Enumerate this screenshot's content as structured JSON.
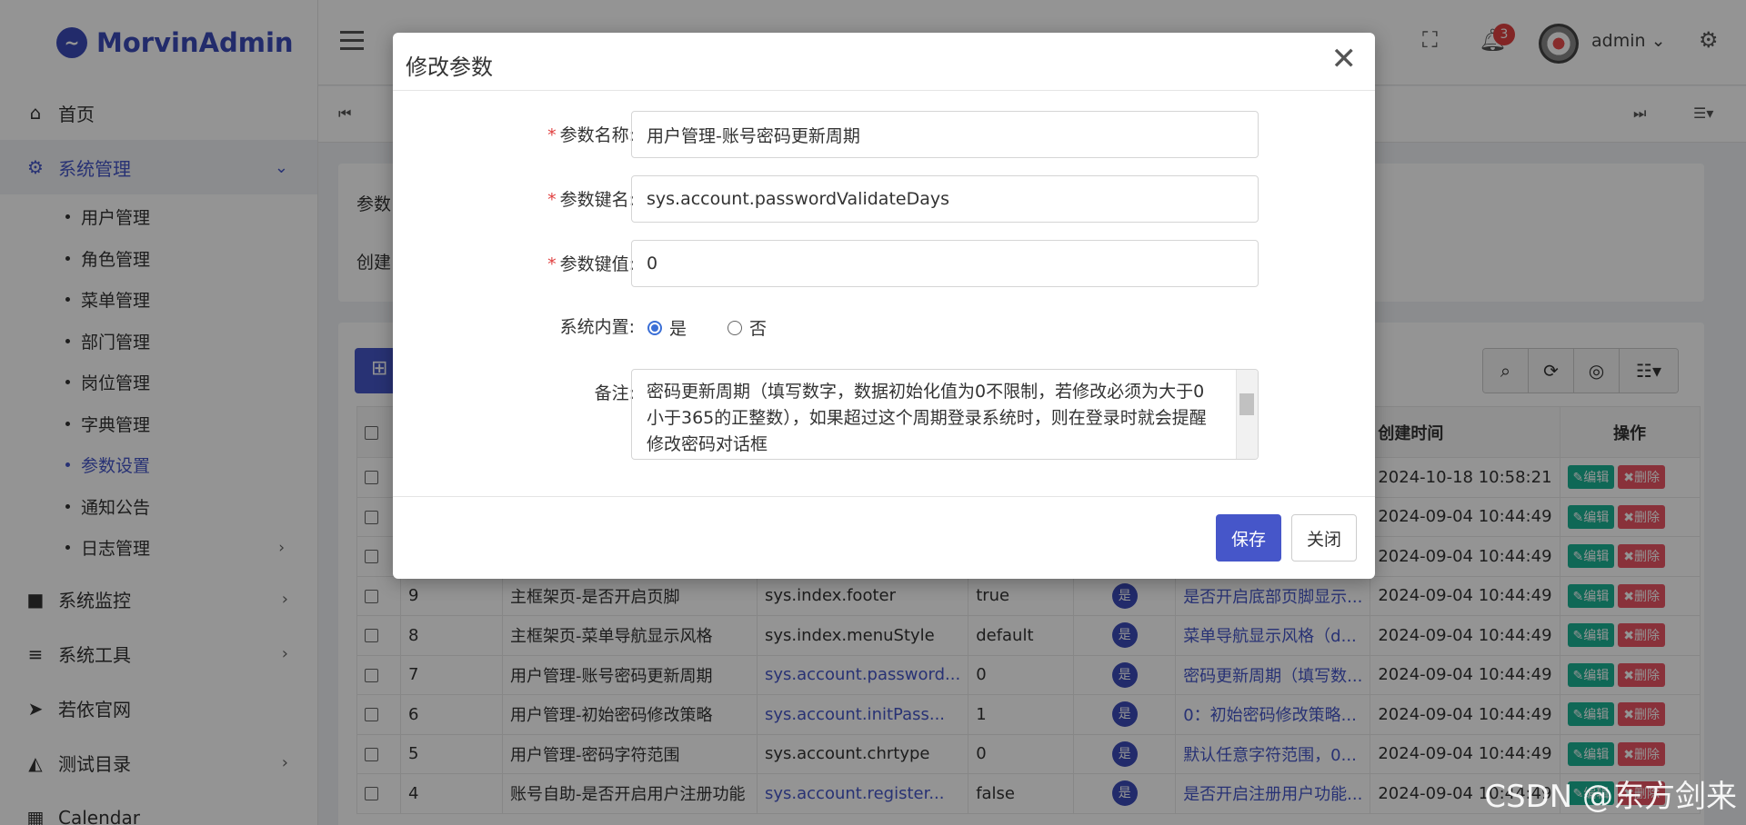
{
  "app": {
    "name": "MorvinAdmin"
  },
  "sidebar": {
    "items": [
      {
        "label": "首页",
        "icon": "home-icon"
      },
      {
        "label": "系统管理",
        "icon": "gear-icon"
      },
      {
        "label": "系统监控",
        "icon": "video-icon"
      },
      {
        "label": "系统工具",
        "icon": "list-icon"
      },
      {
        "label": "若依官网",
        "icon": "send-icon"
      },
      {
        "label": "测试目录",
        "icon": "area-chart-icon"
      },
      {
        "label": "Calendar",
        "icon": "calendar-icon"
      }
    ],
    "sub_items": [
      {
        "label": "用户管理"
      },
      {
        "label": "角色管理"
      },
      {
        "label": "菜单管理"
      },
      {
        "label": "部门管理"
      },
      {
        "label": "岗位管理"
      },
      {
        "label": "字典管理"
      },
      {
        "label": "参数设置"
      },
      {
        "label": "通知公告"
      },
      {
        "label": "日志管理"
      }
    ]
  },
  "header": {
    "username": "admin",
    "notification_count": "3"
  },
  "search": {
    "label1": "参数",
    "label2": "创建"
  },
  "table": {
    "headers": {
      "create_time": "创建时间",
      "actions": "操作"
    },
    "edit_label": "编辑",
    "delete_label": "删除",
    "yes_badge": "是",
    "rows": [
      {
        "time": "2024-10-18 10:58:21"
      },
      {
        "time": "2024-09-04 10:44:49"
      },
      {
        "time": "2024-09-04 10:44:49"
      },
      {
        "id": "9",
        "name": "主框架页-是否开启页脚",
        "key": "sys.index.footer",
        "value": "true",
        "remark": "是否开启底部页脚显示...",
        "time": "2024-09-04 10:44:49"
      },
      {
        "id": "8",
        "name": "主框架页-菜单导航显示风格",
        "key": "sys.index.menuStyle",
        "value": "default",
        "remark": "菜单导航显示风格（d...",
        "time": "2024-09-04 10:44:49"
      },
      {
        "id": "7",
        "name": "用户管理-账号密码更新周期",
        "key": "sys.account.password...",
        "value": "0",
        "remark": "密码更新周期（填写数...",
        "time": "2024-09-04 10:44:49"
      },
      {
        "id": "6",
        "name": "用户管理-初始密码修改策略",
        "key": "sys.account.initPass...",
        "value": "1",
        "remark": "0：初始密码修改策略...",
        "time": "2024-09-04 10:44:49"
      },
      {
        "id": "5",
        "name": "用户管理-密码字符范围",
        "key": "sys.account.chrtype",
        "value": "0",
        "remark": "默认任意字符范围，0...",
        "time": "2024-09-04 10:44:49"
      },
      {
        "id": "4",
        "name": "账号自助-是否开启用户注册功能",
        "key": "sys.account.register...",
        "value": "false",
        "remark": "是否开启注册用户功能...",
        "time": "2024-09-04 10:44:49"
      }
    ]
  },
  "modal": {
    "title": "修改参数",
    "fields": {
      "name_label": "参数名称:",
      "name_value": "用户管理-账号密码更新周期",
      "key_label": "参数键名:",
      "key_value": "sys.account.passwordValidateDays",
      "value_label": "参数键值:",
      "value_value": "0",
      "builtin_label": "系统内置:",
      "builtin_yes": "是",
      "builtin_no": "否",
      "builtin_selected": "是",
      "remark_label": "备注:",
      "remark_value": "密码更新周期（填写数字，数据初始化值为0不限制，若修改必须为大于0小于365的正整数），如果超过这个周期登录系统时，则在登录时就会提醒修改密码对话框"
    },
    "save_label": "保存",
    "close_label": "关闭"
  },
  "watermark": "CSDN @东方剑来",
  "colors": {
    "primary": "#4656c9",
    "edit": "#1ab394",
    "delete": "#ed5565",
    "required": "#e04040"
  }
}
